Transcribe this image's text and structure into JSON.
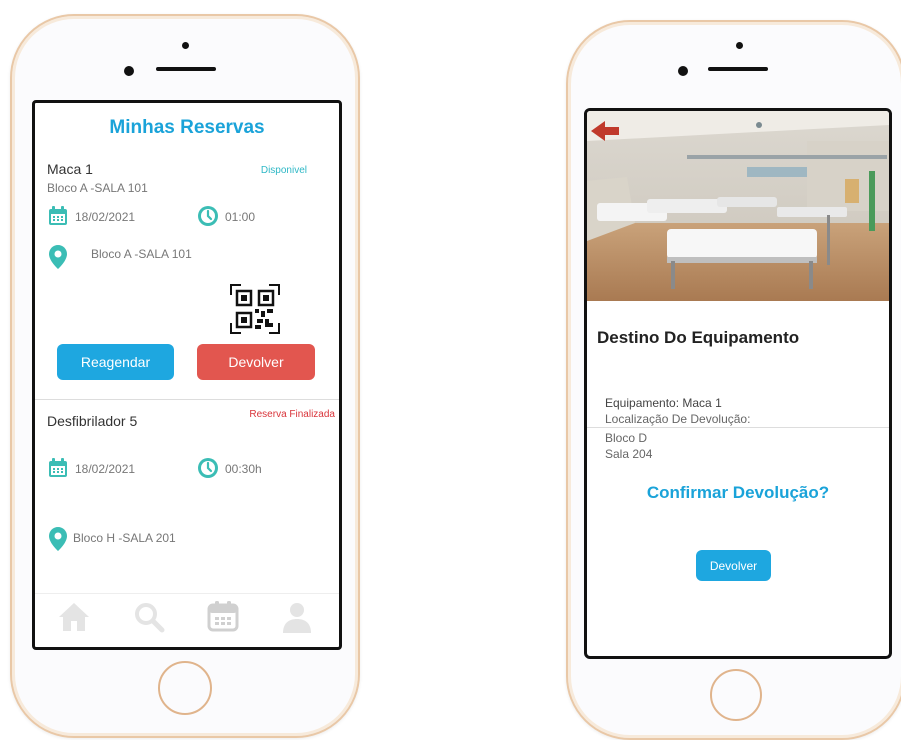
{
  "left": {
    "title": "Minhas Reservas",
    "reservations": [
      {
        "name": "Maca 1",
        "location": "Bloco A -SALA 101",
        "status": "Disponivel",
        "date": "18/02/2021",
        "time": "01:00",
        "place": "Bloco A -SALA 101"
      },
      {
        "name": "Desfibrilador 5",
        "status": "Reserva Finalizada",
        "date": "18/02/2021",
        "time": "00:30h",
        "place": "Bloco H -SALA 201"
      }
    ],
    "buttons": {
      "reschedule": "Reagendar",
      "return": "Devolver"
    },
    "nav": [
      "home-icon",
      "search-icon",
      "calendar-icon",
      "user-icon"
    ]
  },
  "right": {
    "title": "Destino Do Equipamento",
    "equipment": "Equipamento: Maca 1",
    "return_location_label": "Localização De Devolução:",
    "block": "Bloco D",
    "room": "Sala 204",
    "confirm": "Confirmar Devolução?",
    "button": "Devolver"
  },
  "colors": {
    "accent": "#1aa3d9",
    "button_blue": "#1ea7e0",
    "button_red": "#e2564f",
    "status_available": "#2fb8c6",
    "status_finished": "#d9343a",
    "icon_teal": "#3bbdb5",
    "phone_frame": "#e9c8a7"
  }
}
